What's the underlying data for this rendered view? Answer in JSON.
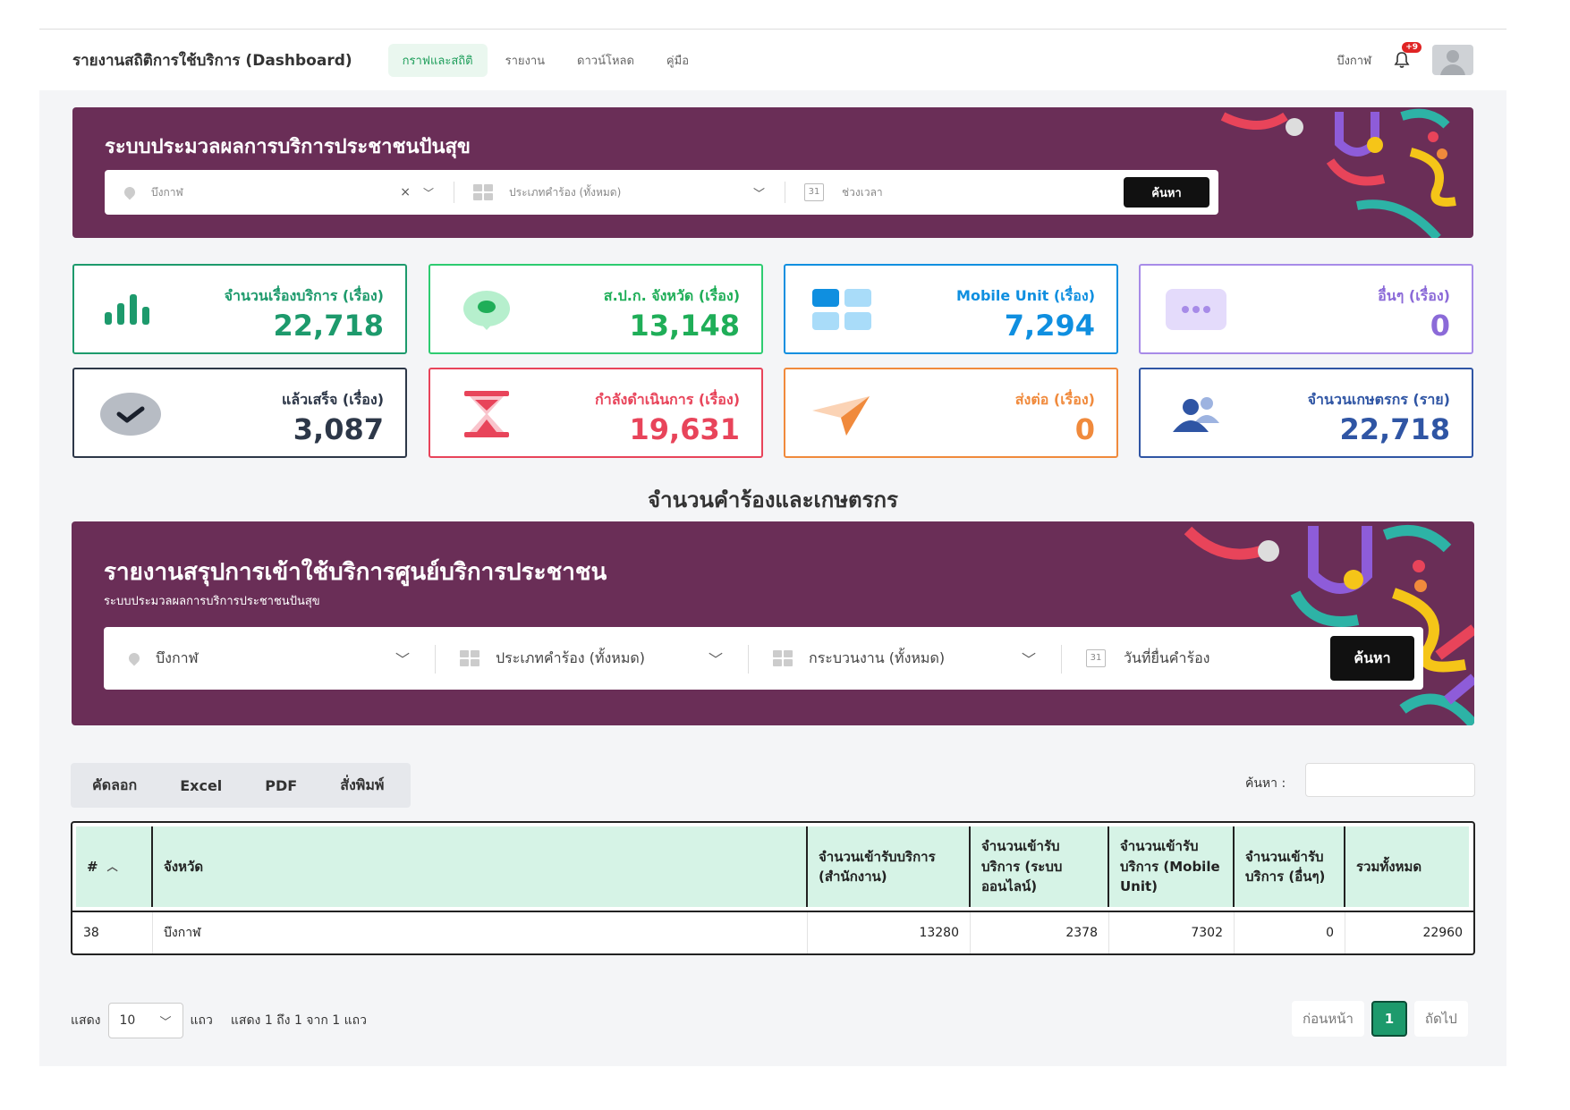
{
  "app": {
    "title": "รายงานสถิติการใช้บริการ (Dashboard)"
  },
  "nav": {
    "tabs": [
      {
        "label": "กราฟและสถิติ",
        "active": true
      },
      {
        "label": "รายงาน"
      },
      {
        "label": "ดาวน์โหลด"
      },
      {
        "label": "คู่มือ"
      }
    ],
    "province": "บึงกาฬ",
    "notification_badge": "+9"
  },
  "banner1": {
    "title": "ระบบประมวลผลการบริการประชาชนปันสุข",
    "province_placeholder": "บึงกาฬ",
    "type_placeholder": "ประเภทคำร้อง (ทั้งหมด)",
    "date_placeholder": "ช่วงเวลา",
    "calendar_day": "31",
    "search_button": "ค้นหา"
  },
  "stats": [
    {
      "label": "จำนวนเรื่องบริการ (เรื่อง)",
      "value": "22,718",
      "color": "#1d9a6c",
      "icon": "bar-chart-icon"
    },
    {
      "label": "ส.ป.ก. จังหวัด (เรื่อง)",
      "value": "13,148",
      "color": "#2ecc71",
      "icon": "location-pin-icon"
    },
    {
      "label": "Mobile Unit (เรื่อง)",
      "value": "7,294",
      "color": "#0f8fe0",
      "icon": "grid-icon"
    },
    {
      "label": "อื่นๆ (เรื่อง)",
      "value": "0",
      "color": "#a78be8",
      "icon": "more-icon"
    },
    {
      "label": "แล้วเสร็จ (เรื่อง)",
      "value": "3,087",
      "color": "#2d3748",
      "icon": "check-icon"
    },
    {
      "label": "กำลังดำเนินการ (เรื่อง)",
      "value": "19,631",
      "color": "#e8445a",
      "icon": "hourglass-icon"
    },
    {
      "label": "ส่งต่อ (เรื่อง)",
      "value": "0",
      "color": "#f08a3c",
      "icon": "send-icon"
    },
    {
      "label": "จำนวนเกษตรกร (ราย)",
      "value": "22,718",
      "color": "#2f55a4",
      "icon": "users-icon"
    }
  ],
  "section_title": "จำนวนคำร้องและเกษตรกร",
  "banner2": {
    "title": "รายงานสรุปการเข้าใช้บริการศูนย์บริการประชาชน",
    "subtitle": "ระบบประมวลผลการบริการประชาชนปันสุข",
    "province": "บึงกาฬ",
    "type": "ประเภทคำร้อง (ทั้งหมด)",
    "process": "กระบวนงาน (ทั้งหมด)",
    "date": "วันที่ยื่นคำร้อง",
    "calendar_day": "31",
    "search_button": "ค้นหา"
  },
  "toolbar": {
    "copy": "คัดลอก",
    "excel": "Excel",
    "pdf": "PDF",
    "print": "สั่งพิมพ์",
    "search_label": "ค้นหา :"
  },
  "table": {
    "headers": {
      "no": "#",
      "province": "จังหวัด",
      "office": "จำนวนเข้ารับบริการ (สำนักงาน)",
      "online": "จำนวนเข้ารับ บริการ (ระบบออนไลน์)",
      "mobile": "จำนวนเข้ารับ บริการ (Mobile Unit)",
      "other": "จำนวนเข้ารับ บริการ (อื่นๆ)",
      "total": "รวมทั้งหมด"
    },
    "rows": [
      {
        "no": "38",
        "province": "บึงกาฬ",
        "office": "13280",
        "online": "2378",
        "mobile": "7302",
        "other": "0",
        "total": "22960"
      }
    ]
  },
  "pager": {
    "show": "แสดง",
    "page_length": "10",
    "rows_label": "แถว",
    "info": "แสดง 1 ถึง 1 จาก 1 แถว",
    "prev": "ก่อนหน้า",
    "current": "1",
    "next": "ถัดไป"
  }
}
